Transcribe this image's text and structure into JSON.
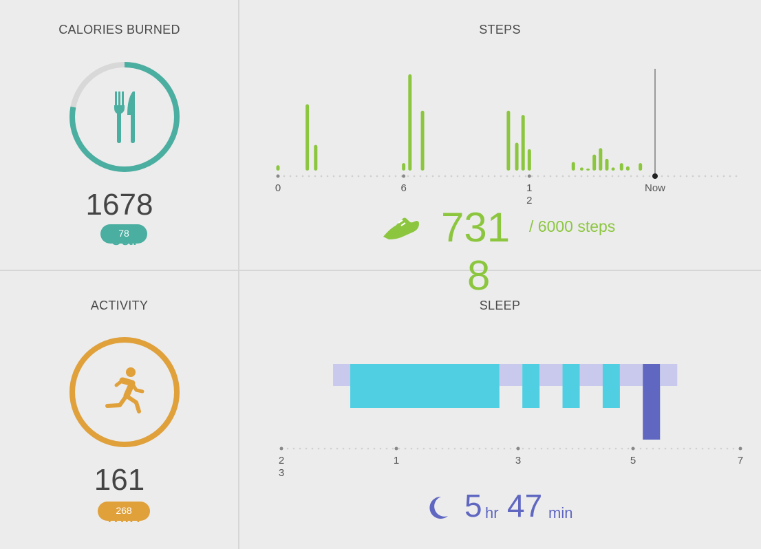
{
  "calories": {
    "title": "CALORIES BURNED",
    "value": "1678",
    "pill_value": "78",
    "unit": "cal",
    "progress": 0.78,
    "icon": "fork-knife-icon",
    "color": "#4aaea0"
  },
  "steps": {
    "title": "STEPS",
    "value_line1": "731",
    "value_line2": "8",
    "goal": "/ 6000 steps",
    "icon": "shoe-icon",
    "color": "#8cc63f",
    "chart_data": {
      "type": "bar",
      "x_ticks": [
        "0",
        "6",
        "1\n2",
        "Now"
      ],
      "x_tick_hours": [
        0,
        6,
        12,
        18
      ],
      "now_hour": 18,
      "bars": [
        {
          "x": 0.0,
          "v": 5
        },
        {
          "x": 1.4,
          "v": 62
        },
        {
          "x": 1.8,
          "v": 24
        },
        {
          "x": 6.0,
          "v": 7
        },
        {
          "x": 6.3,
          "v": 90
        },
        {
          "x": 6.9,
          "v": 56
        },
        {
          "x": 11.0,
          "v": 56
        },
        {
          "x": 11.4,
          "v": 26
        },
        {
          "x": 11.7,
          "v": 52
        },
        {
          "x": 12.0,
          "v": 20
        },
        {
          "x": 14.1,
          "v": 8
        },
        {
          "x": 14.5,
          "v": 3
        },
        {
          "x": 14.8,
          "v": 2
        },
        {
          "x": 15.1,
          "v": 15
        },
        {
          "x": 15.4,
          "v": 21
        },
        {
          "x": 15.7,
          "v": 11
        },
        {
          "x": 16.0,
          "v": 3
        },
        {
          "x": 16.4,
          "v": 7
        },
        {
          "x": 16.7,
          "v": 4
        },
        {
          "x": 17.3,
          "v": 7
        }
      ],
      "y_max": 90
    }
  },
  "activity": {
    "title": "ACTIVITY",
    "value": "161",
    "pill_value": "268",
    "unit": "min",
    "progress": 1.0,
    "icon": "running-person-icon",
    "color": "#e0a03a"
  },
  "sleep": {
    "title": "SLEEP",
    "hours": "5",
    "hours_unit": "hr",
    "minutes": "47",
    "minutes_unit": "min",
    "icon": "moon-icon",
    "color": "#5f67c1",
    "chart_data": {
      "type": "bar",
      "x_ticks": [
        "2\n3",
        "1",
        "3",
        "5",
        "7"
      ],
      "x_tick_hours": [
        23,
        1,
        3,
        5,
        7
      ],
      "segments": [
        {
          "start": 23.9,
          "end": 24.2,
          "stage": "awake"
        },
        {
          "start": 24.2,
          "end": 26.8,
          "stage": "light"
        },
        {
          "start": 26.8,
          "end": 27.2,
          "stage": "awake"
        },
        {
          "start": 27.2,
          "end": 27.5,
          "stage": "light"
        },
        {
          "start": 27.5,
          "end": 27.9,
          "stage": "awake"
        },
        {
          "start": 27.9,
          "end": 28.2,
          "stage": "light"
        },
        {
          "start": 28.2,
          "end": 28.6,
          "stage": "awake"
        },
        {
          "start": 28.6,
          "end": 28.9,
          "stage": "light"
        },
        {
          "start": 28.9,
          "end": 29.3,
          "stage": "awake"
        },
        {
          "start": 29.3,
          "end": 29.6,
          "stage": "deep"
        },
        {
          "start": 29.6,
          "end": 29.9,
          "stage": "awake"
        }
      ],
      "stage_colors": {
        "awake": "#c8c9ec",
        "light": "#4fcfe1",
        "deep": "#5f67c1"
      }
    }
  }
}
